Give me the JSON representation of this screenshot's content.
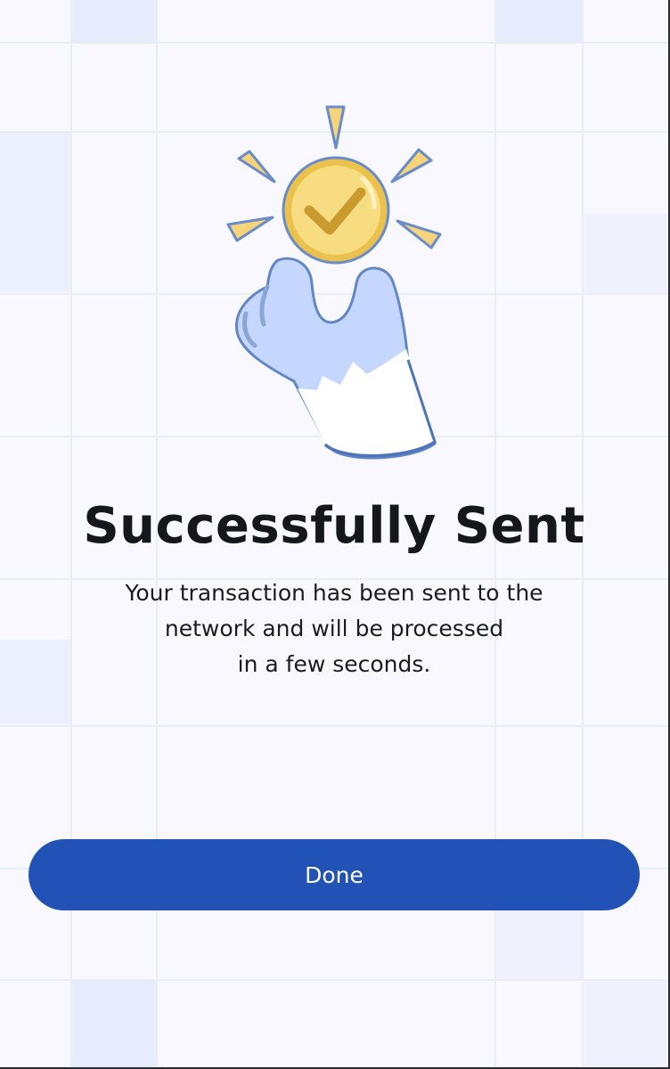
{
  "success": {
    "title": "Successfully Sent",
    "message_lines": [
      "Your transaction has been sent to the",
      "network and will be processed",
      "in a few seconds."
    ]
  },
  "actions": {
    "done_label": "Done"
  },
  "colors": {
    "background": "#f8f8fe",
    "primary": "#2352b6",
    "coin": "#f8dc82",
    "hand": "#c6d7ff",
    "outline": "#5f82c0"
  },
  "icons": {
    "illustration": "hand-holding-check-coin-icon"
  }
}
